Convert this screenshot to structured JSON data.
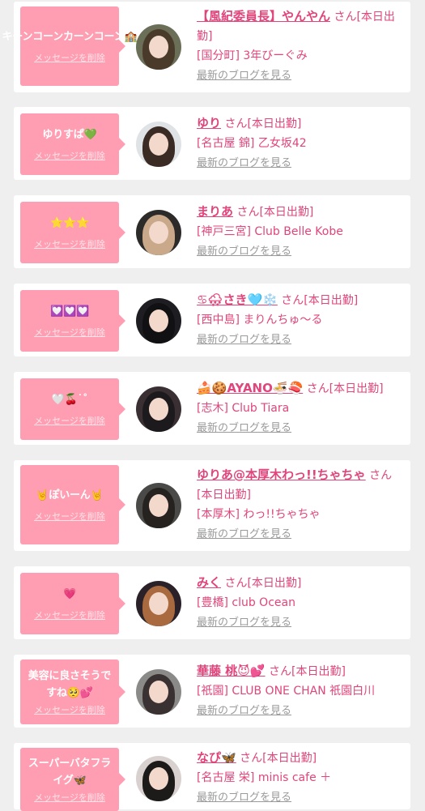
{
  "cards": [
    {
      "message": "キーンコーンカーンコーン🏫",
      "delete_label": "メッセージを削除",
      "name": "【風紀委員長】やんやん",
      "suffix": " さん[本日出勤]",
      "shop": "[国分町] 3年びーぐみ",
      "blog_label": "最新のブログを見る"
    },
    {
      "message": "ゆりすぱ💚",
      "delete_label": "メッセージを削除",
      "name": "ゆり",
      "suffix": " さん[本日出勤]",
      "shop": "[名古屋 錦] 乙女坂42",
      "blog_label": "最新のブログを見る"
    },
    {
      "message": "⭐⭐⭐",
      "delete_label": "メッセージを削除",
      "name": "まりあ",
      "suffix": " さん[本日出勤]",
      "shop": "[神戸三宮] Club Belle Kobe",
      "blog_label": "最新のブログを見る"
    },
    {
      "message": "💟💟💟",
      "delete_label": "メッセージを削除",
      "name": "♋🌨さき🩵❄️",
      "suffix": " さん[本日出勤]",
      "shop": "[西中島] まりんちゅ〜る",
      "blog_label": "最新のブログを見る"
    },
    {
      "message": "🤍🍒˙˚",
      "delete_label": "メッセージを削除",
      "name": "🍰🍪AYANO🍜🍣",
      "suffix": " さん[本日出勤]",
      "shop": "[志木] Club Tiara",
      "blog_label": "最新のブログを見る"
    },
    {
      "message": "🤘ぽいーん🤘",
      "delete_label": "メッセージを削除",
      "name": "ゆりあ@本厚木わっ!!ちゃちゃ",
      "suffix": " さん[本日出勤]",
      "shop": "[本厚木] わっ!!ちゃちゃ",
      "blog_label": "最新のブログを見る"
    },
    {
      "message": "💗",
      "delete_label": "メッセージを削除",
      "name": "みく",
      "suffix": " さん[本日出勤]",
      "shop": "[豊橋] club Ocean",
      "blog_label": "最新のブログを見る"
    },
    {
      "message": "美容に良さそうですね🥺💕",
      "delete_label": "メッセージを削除",
      "name": "華藤 桃😈💕",
      "suffix": " さん[本日出勤]",
      "shop": "[祇園] CLUB ONE CHAN 祇園白川",
      "blog_label": "最新のブログを見る"
    },
    {
      "message": "スーパーバタフライグ🦋",
      "delete_label": "メッセージを削除",
      "name": "なぴ🦋",
      "suffix": " さん[本日出勤]",
      "shop": "[名古屋 栄] minis cafe ＋",
      "blog_label": "最新のブログを見る"
    }
  ],
  "colors": {
    "bubble": "#ff9eb2",
    "accent": "#e0457b",
    "muted": "#9a9a9a"
  }
}
